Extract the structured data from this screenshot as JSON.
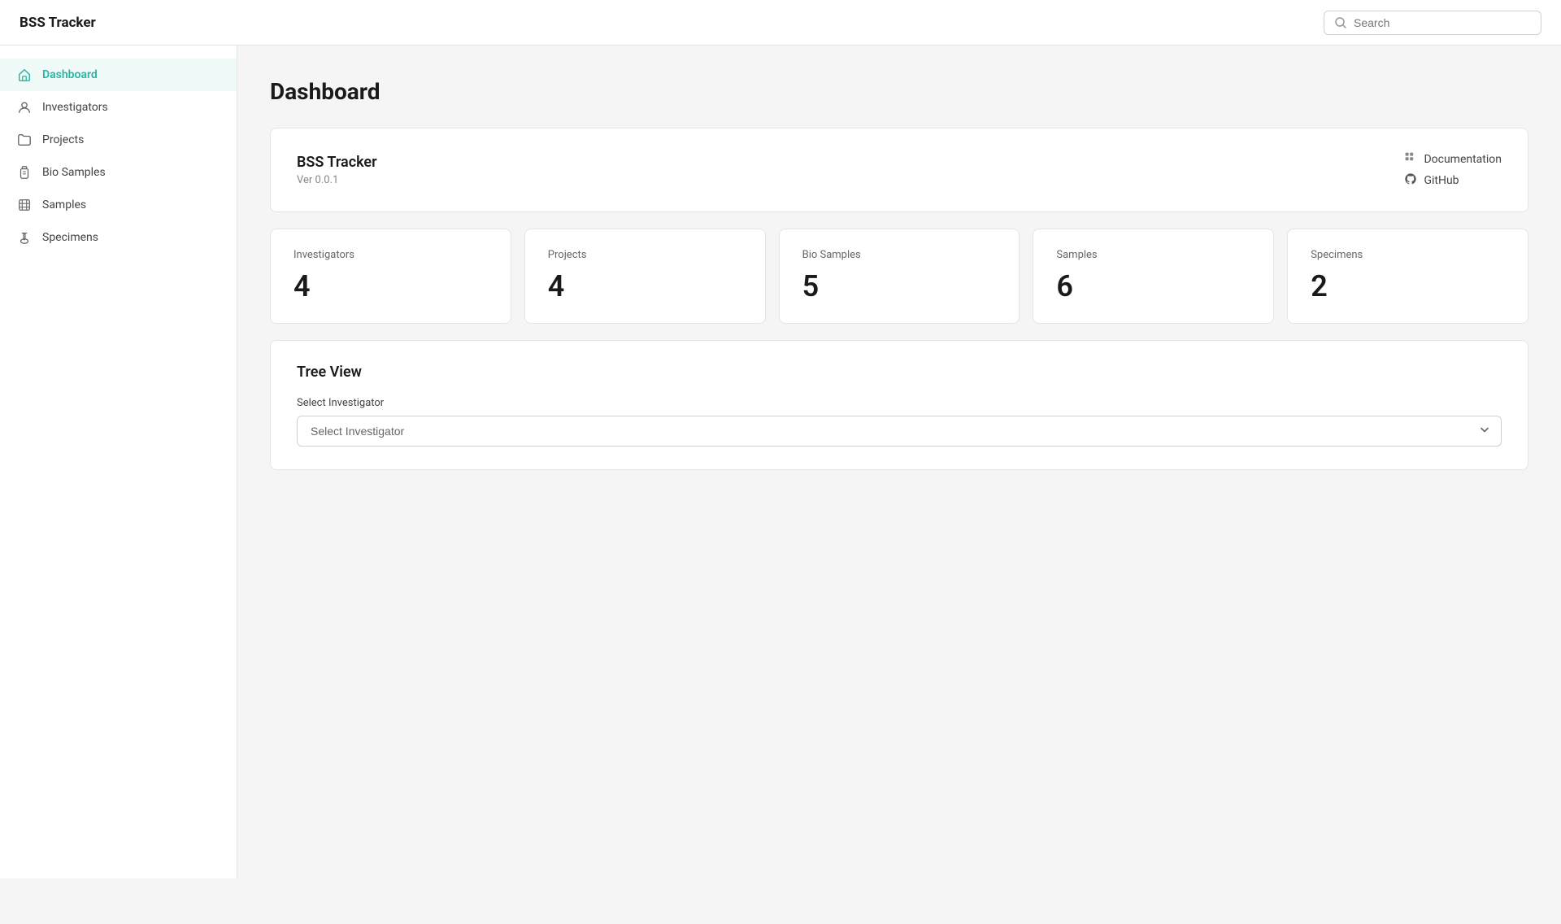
{
  "app": {
    "title": "BSS Tracker",
    "version": "Ver 0.0.1"
  },
  "header": {
    "search_placeholder": "Search"
  },
  "sidebar": {
    "items": [
      {
        "id": "dashboard",
        "label": "Dashboard",
        "icon": "home-icon",
        "active": true
      },
      {
        "id": "investigators",
        "label": "Investigators",
        "icon": "user-icon",
        "active": false
      },
      {
        "id": "projects",
        "label": "Projects",
        "icon": "folder-icon",
        "active": false
      },
      {
        "id": "bio-samples",
        "label": "Bio Samples",
        "icon": "bio-icon",
        "active": false
      },
      {
        "id": "samples",
        "label": "Samples",
        "icon": "sample-icon",
        "active": false
      },
      {
        "id": "specimens",
        "label": "Specimens",
        "icon": "specimen-icon",
        "active": false
      }
    ]
  },
  "main": {
    "page_title": "Dashboard",
    "info_card": {
      "app_name": "BSS Tracker",
      "version": "Ver 0.0.1",
      "links": [
        {
          "id": "documentation",
          "label": "Documentation",
          "icon": "docs-icon"
        },
        {
          "id": "github",
          "label": "GitHub",
          "icon": "github-icon"
        }
      ]
    },
    "stats": [
      {
        "id": "investigators",
        "label": "Investigators",
        "value": "4"
      },
      {
        "id": "projects",
        "label": "Projects",
        "value": "4"
      },
      {
        "id": "bio-samples",
        "label": "Bio Samples",
        "value": "5"
      },
      {
        "id": "samples",
        "label": "Samples",
        "value": "6"
      },
      {
        "id": "specimens",
        "label": "Specimens",
        "value": "2"
      }
    ],
    "tree_view": {
      "title": "Tree View",
      "select_label": "Select Investigator",
      "select_placeholder": "Select Investigator",
      "select_options": [
        {
          "value": "",
          "label": "Select Investigator"
        }
      ]
    }
  }
}
